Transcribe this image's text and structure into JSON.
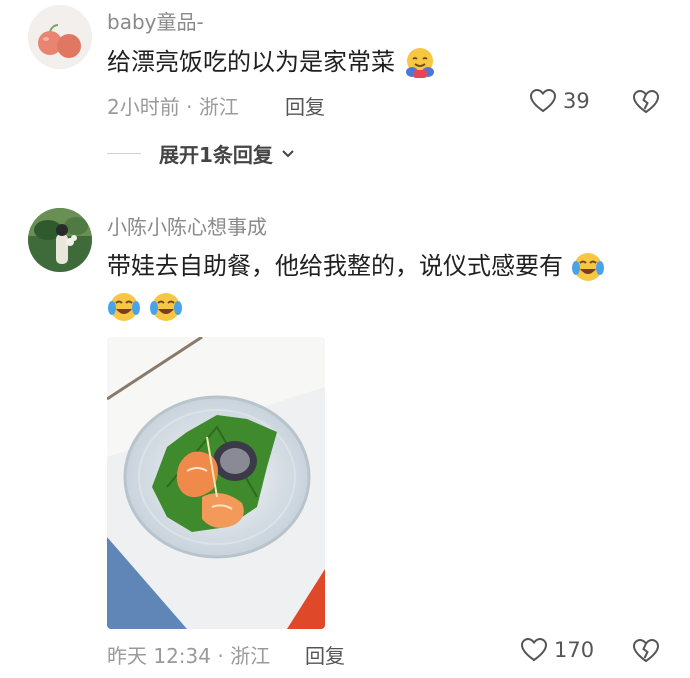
{
  "comments": [
    {
      "username": "baby童品-",
      "text": "给漂亮饭吃的以为是家常菜",
      "time": "2小时前",
      "location": "浙江",
      "reply_label": "回复",
      "likes": "39",
      "expand_label": "展开1条回复"
    },
    {
      "username": "小陈小陈心想事成",
      "text": "带娃去自助餐，他给我整的，说仪式感要有",
      "time": "昨天 12:34",
      "location": "浙江",
      "reply_label": "回复",
      "likes": "170"
    }
  ],
  "separator": "·",
  "icons": {
    "like": "heart-outline-icon",
    "dislike": "broken-heart-icon",
    "expand": "chevron-down-icon",
    "emoji_hug": "hugging-face-emoji",
    "emoji_laugh": "tears-of-joy-emoji"
  }
}
